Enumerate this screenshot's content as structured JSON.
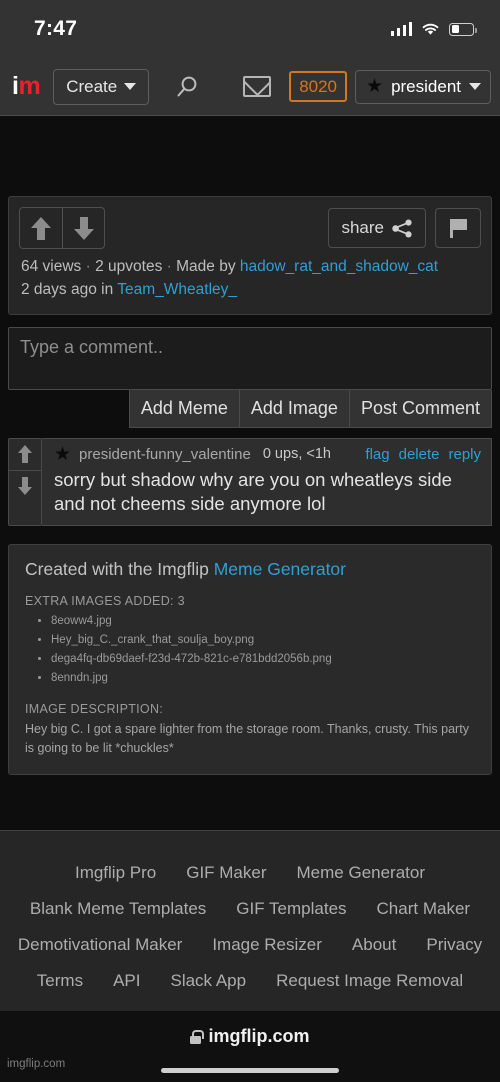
{
  "status_bar": {
    "time": "7:47",
    "signal_icon": "cellular-bars-icon",
    "wifi_icon": "wifi-icon",
    "battery_icon": "battery-icon",
    "battery_level_pct": 35
  },
  "header": {
    "logo_i": "i",
    "logo_m": "m",
    "create_label": "Create",
    "search_icon": "search-icon",
    "mail_icon": "mail-icon",
    "points": "8020",
    "points_color": "#d4761e",
    "user_star_icon": "star-icon",
    "username": "president",
    "chevron_icon": "chevron-down-icon"
  },
  "post": {
    "upvote_icon": "arrow-up-icon",
    "downvote_icon": "arrow-down-icon",
    "share_label": "share",
    "share_icon": "share-icon",
    "flag_icon": "flag-icon",
    "views": "64 views",
    "sep1": "·",
    "upvotes": "2 upvotes",
    "sep2": "·",
    "made_by_label": "Made by",
    "author": "hadow_rat_and_shadow_cat",
    "age": "2 days ago in",
    "stream": "Team_Wheatley_"
  },
  "composer": {
    "placeholder": "Type a comment..",
    "value": "",
    "add_meme_label": "Add Meme",
    "add_image_label": "Add Image",
    "post_comment_label": "Post Comment"
  },
  "comment": {
    "upvote_icon": "arrow-up-icon",
    "downvote_icon": "arrow-down-icon",
    "avatar_icon": "star-icon",
    "username": "president-funny_valentine",
    "ups": "0 ups, <1h",
    "flag_label": "flag",
    "delete_label": "delete",
    "reply_label": "reply",
    "text": "sorry but shadow why are you on wheatleys side and not cheems side anymore lol"
  },
  "info_box": {
    "created_prefix": "Created with the Imgflip",
    "created_link": "Meme Generator",
    "extra_images_title": "EXTRA IMAGES ADDED: 3",
    "extra_images": [
      "8eoww4.jpg",
      "Hey_big_C._crank_that_soulja_boy.png",
      "dega4fq-db69daef-f23d-472b-821c-e781bdd2056b.png",
      "8enndn.jpg"
    ],
    "description_title": "IMAGE DESCRIPTION:",
    "description": "Hey big C. I got a spare lighter from the storage room. Thanks, crusty. This party is going to be lit *chuckles*"
  },
  "footer": {
    "rows": [
      [
        "Imgflip Pro",
        "GIF Maker",
        "Meme Generator"
      ],
      [
        "Blank Meme Templates",
        "GIF Templates",
        "Chart Maker"
      ],
      [
        "Demotivational Maker",
        "Image Resizer",
        "About",
        "Privacy"
      ],
      [
        "Terms",
        "API",
        "Slack App",
        "Request Image Removal"
      ]
    ]
  },
  "browser": {
    "lock_icon": "lock-icon",
    "url": "imgflip.com",
    "watermark": "imgflip.com"
  }
}
